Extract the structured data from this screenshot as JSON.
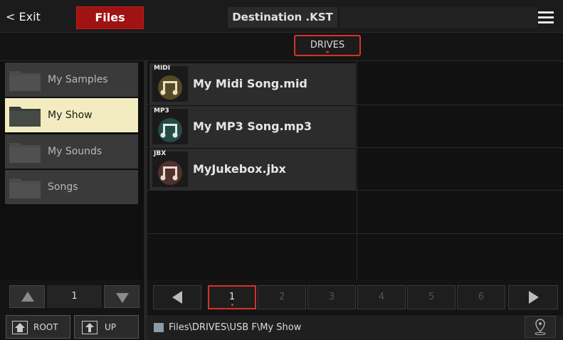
{
  "topbar": {
    "exit_label": "< Exit",
    "files_label": "Files",
    "destination_label": "Destination .KST",
    "menu_icon": "hamburger-icon"
  },
  "tabs": {
    "drives_label": "DRIVES"
  },
  "folders": [
    {
      "label": "My Samples",
      "selected": false
    },
    {
      "label": "My Show",
      "selected": true
    },
    {
      "label": "My Sounds",
      "selected": false
    },
    {
      "label": "Songs",
      "selected": false
    }
  ],
  "files": [
    {
      "type_tag": "MIDI",
      "name": "My Midi Song.mid",
      "icon": "midi-file-icon",
      "color": "#c9a63a"
    },
    {
      "type_tag": "MP3",
      "name": "My MP3 Song.mp3",
      "icon": "mp3-file-icon",
      "color": "#3ea79c"
    },
    {
      "type_tag": "JBX",
      "name": "MyJukebox.jbx",
      "icon": "jukebox-file-icon",
      "color": "#b8604e"
    }
  ],
  "left_nav": {
    "page": "1",
    "root_label": "ROOT",
    "up_label": "UP"
  },
  "pager": {
    "pages": [
      "1",
      "2",
      "3",
      "4",
      "5",
      "6"
    ],
    "active_page": "1"
  },
  "path": {
    "text": "Files\\DRIVES\\USB F\\My Show"
  },
  "colors": {
    "accent_red": "#d6322a",
    "files_button": "#a11212",
    "selected_folder": "#f2ecc0"
  }
}
